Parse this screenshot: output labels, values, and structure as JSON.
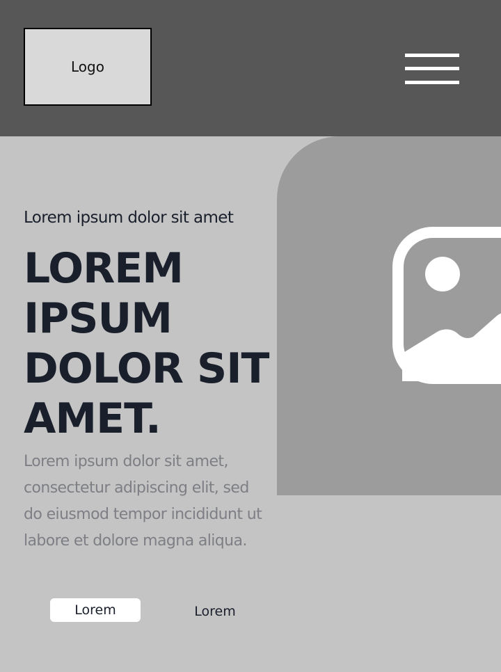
{
  "header": {
    "logo_label": "Logo",
    "menu_icon": "hamburger-menu-icon"
  },
  "hero": {
    "eyebrow": "Lorem ipsum dolor sit amet",
    "headline_lines": [
      "LOREM",
      "IPSUM",
      "DOLOR SIT",
      "AMET."
    ],
    "body": "Lorem ipsum dolor sit amet, consectetur adipiscing elit, sed do eiusmod tempor incididunt ut labore et dolore magna aliqua.",
    "image_icon": "image-placeholder-icon"
  },
  "actions": {
    "primary_label": "Lorem",
    "secondary_label": "Lorem"
  },
  "colors": {
    "header_bg": "#575757",
    "page_bg": "#c4c4c4",
    "media_bg": "#9c9c9c",
    "heading_text": "#1a1f2c",
    "body_text": "#7d7f85"
  }
}
